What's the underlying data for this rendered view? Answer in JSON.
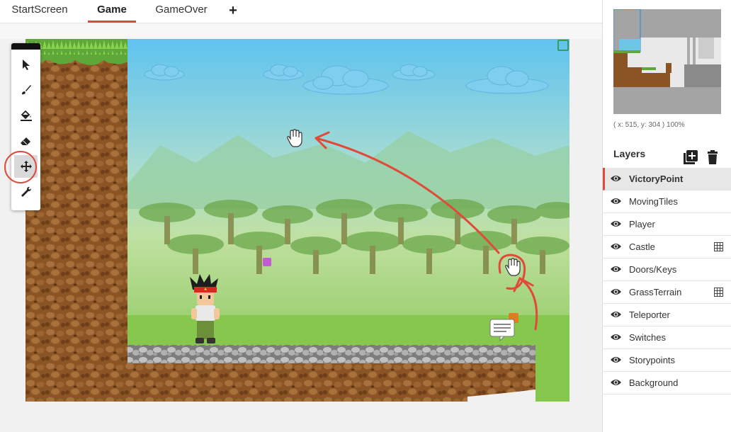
{
  "tabs": {
    "items": [
      {
        "label": "StartScreen",
        "active": false
      },
      {
        "label": "Game",
        "active": true
      },
      {
        "label": "GameOver",
        "active": false
      }
    ],
    "add_label": "+"
  },
  "tools": [
    {
      "icon": "pointer-icon",
      "selected": false
    },
    {
      "icon": "brush-icon",
      "selected": false
    },
    {
      "icon": "paint-bucket-icon",
      "selected": false
    },
    {
      "icon": "eraser-icon",
      "selected": false
    },
    {
      "icon": "move-arrows-icon",
      "selected": true
    },
    {
      "icon": "wrench-icon",
      "selected": false
    }
  ],
  "minimap": {
    "coords": "( x: 515, y: 304 ) 100%"
  },
  "layers": {
    "title": "Layers",
    "add_icon": "add-layer-icon",
    "delete_icon": "trash-icon",
    "items": [
      {
        "name": "VictoryPoint",
        "active": true,
        "tile_layer": false
      },
      {
        "name": "MovingTiles",
        "active": false,
        "tile_layer": false
      },
      {
        "name": "Player",
        "active": false,
        "tile_layer": false
      },
      {
        "name": "Castle",
        "active": false,
        "tile_layer": true
      },
      {
        "name": "Doors/Keys",
        "active": false,
        "tile_layer": false
      },
      {
        "name": "GrassTerrain",
        "active": false,
        "tile_layer": true
      },
      {
        "name": "Teleporter",
        "active": false,
        "tile_layer": false
      },
      {
        "name": "Switches",
        "active": false,
        "tile_layer": false
      },
      {
        "name": "Storypoints",
        "active": false,
        "tile_layer": false
      },
      {
        "name": "Background",
        "active": false,
        "tile_layer": false
      }
    ]
  },
  "colors": {
    "accent": "#e0483a",
    "sky_top": "#5fc3ef",
    "grass_bottom": "#7cc146",
    "dirt": "#8a5424",
    "stone": "#a7a7a7"
  }
}
